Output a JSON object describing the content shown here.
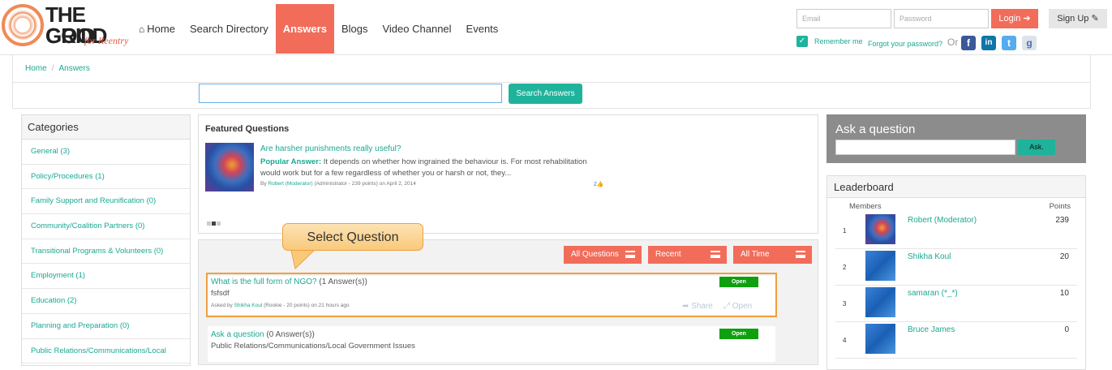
{
  "brand": {
    "line1": "THE GOOD",
    "line2": "GRID",
    "tagline": "for Reentry"
  },
  "nav": [
    {
      "label": "Home",
      "active": false
    },
    {
      "label": "Search Directory",
      "active": false
    },
    {
      "label": "Answers",
      "active": true
    },
    {
      "label": "Blogs",
      "active": false
    },
    {
      "label": "Video Channel",
      "active": false
    },
    {
      "label": "Events",
      "active": false
    }
  ],
  "auth": {
    "email_placeholder": "Email",
    "password_placeholder": "Password",
    "login_label": "Login",
    "signup_label": "Sign Up",
    "remember_label": "Remember me",
    "forgot_label": "Forgot your password?",
    "or_label": "Or"
  },
  "breadcrumb": [
    "Home",
    "Answers"
  ],
  "search": {
    "button_label": "Search Answers"
  },
  "categories": {
    "title": "Categories",
    "items": [
      "General (3)",
      "Policy/Procedures (1)",
      "Family Support and Reunification (0)",
      "Community/Coalition Partners (0)",
      "Transitional Programs & Volunteers (0)",
      "Employment (1)",
      "Education (2)",
      "Planning and Preparation (0)",
      "Public Relations/Communications/Local"
    ]
  },
  "featured": {
    "title": "Featured Questions",
    "question": "Are harsher punishments really useful?",
    "answer_label": "Popular Answer:",
    "answer_text": " It depends on whether how ingrained the behaviour is. For most rehabilitation would work but for a few regardless of whether you or harsh or not, they...",
    "by": "By",
    "author": "Robert (Moderator)",
    "author_role": "(Administrator - 239 points)",
    "date": "on April 2, 2014",
    "likes": "2"
  },
  "filters": [
    "All Questions",
    "Recent",
    "All Time"
  ],
  "callout": "Select Question",
  "questions": [
    {
      "title": "What is the full form of NGO?",
      "answers": "(1 Answer(s))",
      "body": "fsfsdf",
      "asked_by": "Asked by",
      "author": "Shikha Koul",
      "author_role": "(Rookie - 20 points)",
      "time": "on 21 hours ago",
      "status": "Open",
      "share": "Share",
      "open": "Open"
    },
    {
      "title": "Ask a question",
      "answers": "(0 Answer(s))",
      "body": "Public Relations/Communications/Local Government Issues",
      "status": "Open"
    }
  ],
  "ask": {
    "title": "Ask a question",
    "button": "Ask."
  },
  "leaderboard": {
    "title": "Leaderboard",
    "col_members": "Members",
    "col_points": "Points",
    "rows": [
      {
        "rank": "1",
        "name": "Robert (Moderator)",
        "points": "239"
      },
      {
        "rank": "2",
        "name": "Shikha Koul",
        "points": "20"
      },
      {
        "rank": "3",
        "name": "samaran (*_*)",
        "points": "10"
      },
      {
        "rank": "4",
        "name": "Bruce James",
        "points": "0"
      }
    ]
  }
}
